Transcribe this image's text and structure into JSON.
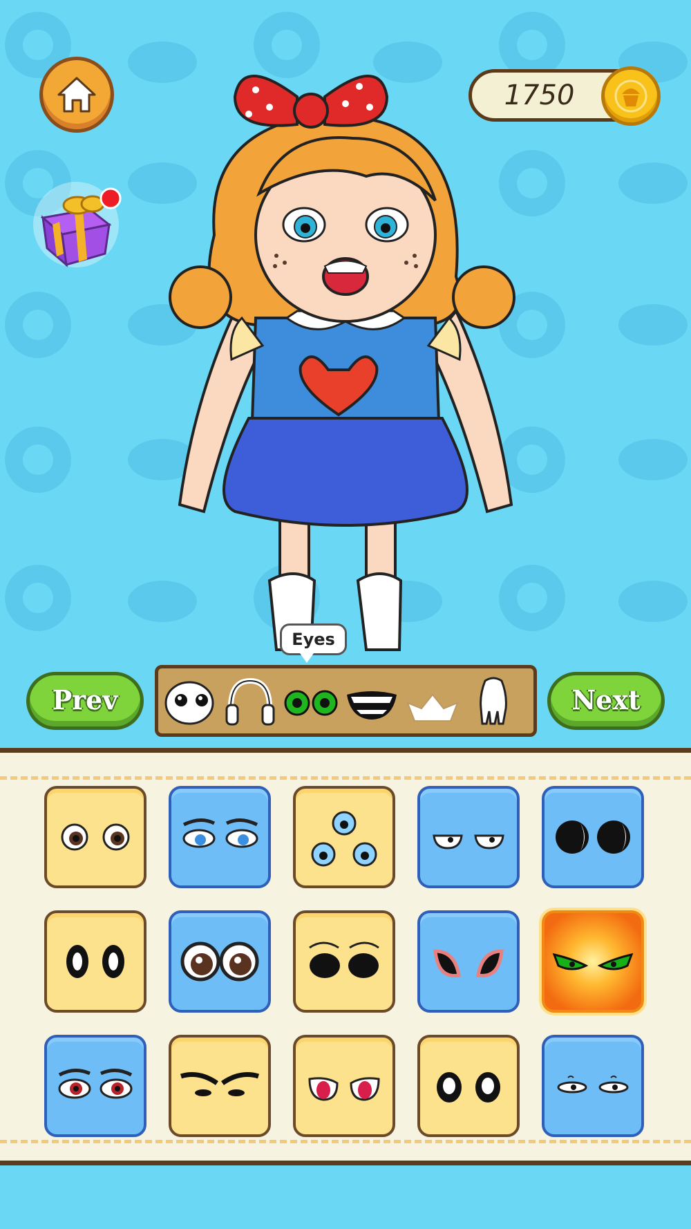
{
  "header": {
    "home_icon": "home-icon",
    "gift_icon": "gift-icon",
    "currency_value": "1750",
    "currency_icon": "cupcake-coin-icon"
  },
  "category_bar": {
    "tooltip": "Eyes",
    "active_category": "eyes",
    "categories": [
      {
        "name": "face"
      },
      {
        "name": "headphones"
      },
      {
        "name": "eyes"
      },
      {
        "name": "mouth"
      },
      {
        "name": "hat"
      },
      {
        "name": "glove"
      }
    ]
  },
  "navigation": {
    "prev_label": "Prev",
    "next_label": "Next"
  },
  "items_grid": {
    "rows": [
      [
        {
          "style": "yellow",
          "eyes": "round-brown-eyes"
        },
        {
          "style": "blue",
          "eyes": "sleepy-blue-eyes"
        },
        {
          "style": "yellow",
          "eyes": "three-blue-eyes"
        },
        {
          "style": "blue",
          "eyes": "bored-eyes"
        },
        {
          "style": "blue",
          "eyes": "crescent-black-eyes"
        }
      ],
      [
        {
          "style": "yellow",
          "eyes": "oval-black-eyes"
        },
        {
          "style": "blue",
          "eyes": "big-brown-eyes"
        },
        {
          "style": "yellow",
          "eyes": "hollow-dark-eyes"
        },
        {
          "style": "blue",
          "eyes": "pink-almond-eyes"
        },
        {
          "style": "special",
          "eyes": "green-glowing-eyes"
        }
      ],
      [
        {
          "style": "blue",
          "eyes": "red-tired-eyes"
        },
        {
          "style": "yellow",
          "eyes": "angry-brows-eyes"
        },
        {
          "style": "yellow",
          "eyes": "red-pink-eyes"
        },
        {
          "style": "yellow",
          "eyes": "black-white-oval-eyes"
        },
        {
          "style": "blue",
          "eyes": "narrow-sleepy-eyes"
        }
      ]
    ]
  },
  "colors": {
    "background": "#6ad8f4",
    "panel": "#f6f3e1",
    "button_green": "#7ed43a",
    "button_orange": "#f3a735",
    "coin_gold": "#f9c21b"
  }
}
